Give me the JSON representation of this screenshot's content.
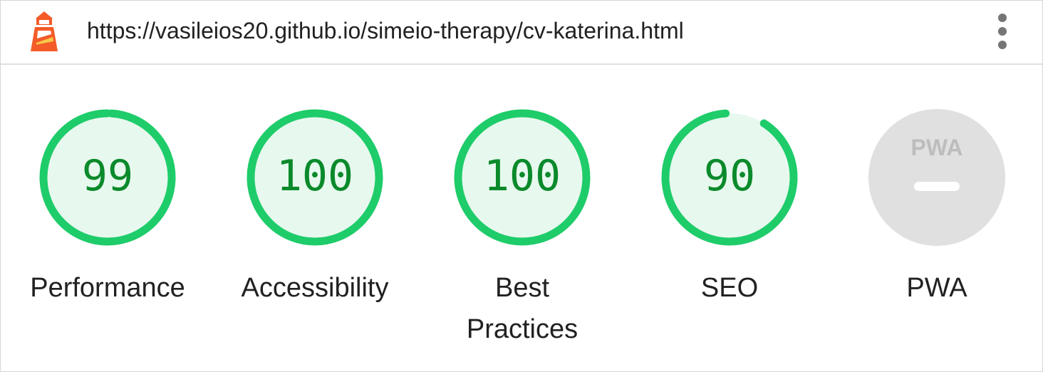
{
  "header": {
    "url": "https://vasileios20.github.io/simeio-therapy/cv-katerina.html",
    "logo_icon": "lighthouse-icon",
    "menu_icon": "vertical-dots-icon"
  },
  "colors": {
    "pass_stroke": "#1ecc6a",
    "pass_fill": "#e7f8ee",
    "pass_text": "#0b8a2b",
    "pwa_fill": "#e0e0e0",
    "pwa_mark": "#ffffff",
    "pwa_text": "#bdbdbd"
  },
  "gauges": [
    {
      "label": "Performance",
      "score": 99
    },
    {
      "label": "Accessibility",
      "score": 100
    },
    {
      "label": "Best Practices",
      "score": 100
    },
    {
      "label": "SEO",
      "score": 90
    }
  ],
  "pwa": {
    "label": "PWA",
    "badge_text": "PWA"
  }
}
